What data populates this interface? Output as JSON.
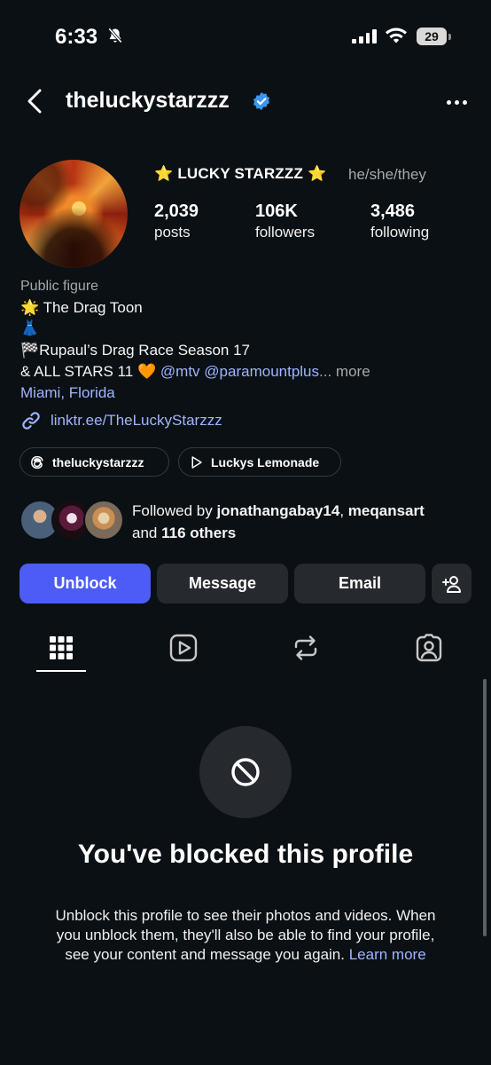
{
  "status_bar": {
    "time": "6:33",
    "battery": "29"
  },
  "header": {
    "username": "theluckystarzzz"
  },
  "profile": {
    "display_name": "LUCKY STARZZZ",
    "pronouns": "he/she/they",
    "stats": {
      "posts": "2,039",
      "posts_label": "posts",
      "followers": "106K",
      "followers_label": "followers",
      "following": "3,486",
      "following_label": "following"
    },
    "category": "Public figure",
    "bio": {
      "line1": "The Drag Toon",
      "line3": "Rupaul’s Drag Race Season 17",
      "line4_a": "& ALL STARS 11",
      "mention1": "@mtv",
      "mention2": "@paramountplus",
      "ellipsis": "...",
      "more": "more"
    },
    "location": "Miami, Florida",
    "link": "linktr.ee/TheLuckyStarzzz",
    "chips": {
      "threads": "theluckystarzzz",
      "lemonade": "Luckys Lemonade"
    },
    "followed_by": {
      "prefix": "Followed by",
      "user1": "jonathangabay14",
      "sep": ",",
      "user2": "meqansart",
      "and": "and",
      "others": "116 others"
    }
  },
  "actions": {
    "unblock": "Unblock",
    "message": "Message",
    "email": "Email"
  },
  "blocked": {
    "title": "You've blocked this profile",
    "description": "Unblock this profile to see their photos and videos. When you unblock them, they'll also be able to find your profile, see your content and message you again.",
    "learn_more": "Learn more"
  },
  "colors": {
    "background": "#0b1014",
    "accent_button": "#4d5cf7",
    "link": "#a0b4ff",
    "verified": "#3897f0",
    "secondary_button": "#26292e"
  }
}
